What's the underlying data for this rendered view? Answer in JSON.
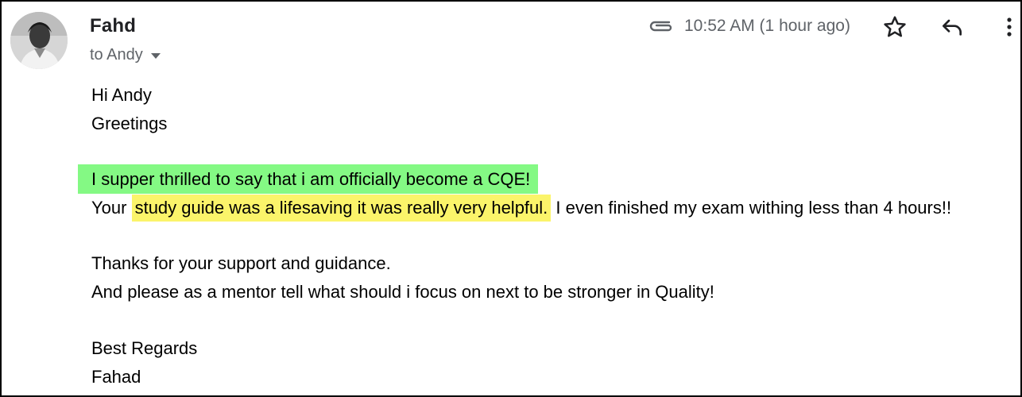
{
  "sender": {
    "name": "Fahd",
    "recipient_label": "to Andy"
  },
  "header": {
    "timestamp": "10:52 AM (1 hour ago)",
    "icons": [
      "paperclip-icon",
      "star-icon",
      "reply-icon",
      "more-vert-icon"
    ]
  },
  "body": {
    "greeting": "Hi Andy",
    "greeting2": "Greetings",
    "highlight_green": "I supper thrilled to say that i am officially become a CQE!",
    "line2_start": "Your ",
    "highlight_yellow": "study guide was a lifesaving it was really very helpful.",
    "line2_end": " I even finished my exam withing less than 4 hours!!",
    "thanks": "Thanks for your support and guidance.",
    "request": "And please as a mentor tell what should i focus on next to be stronger in Quality!",
    "signoff": "Best Regards",
    "signature": "Fahad"
  },
  "colors": {
    "highlight_green": "#84f984",
    "highlight_yellow": "#fbf46a",
    "meta_gray": "#5f6368",
    "text_dark": "#202124"
  }
}
